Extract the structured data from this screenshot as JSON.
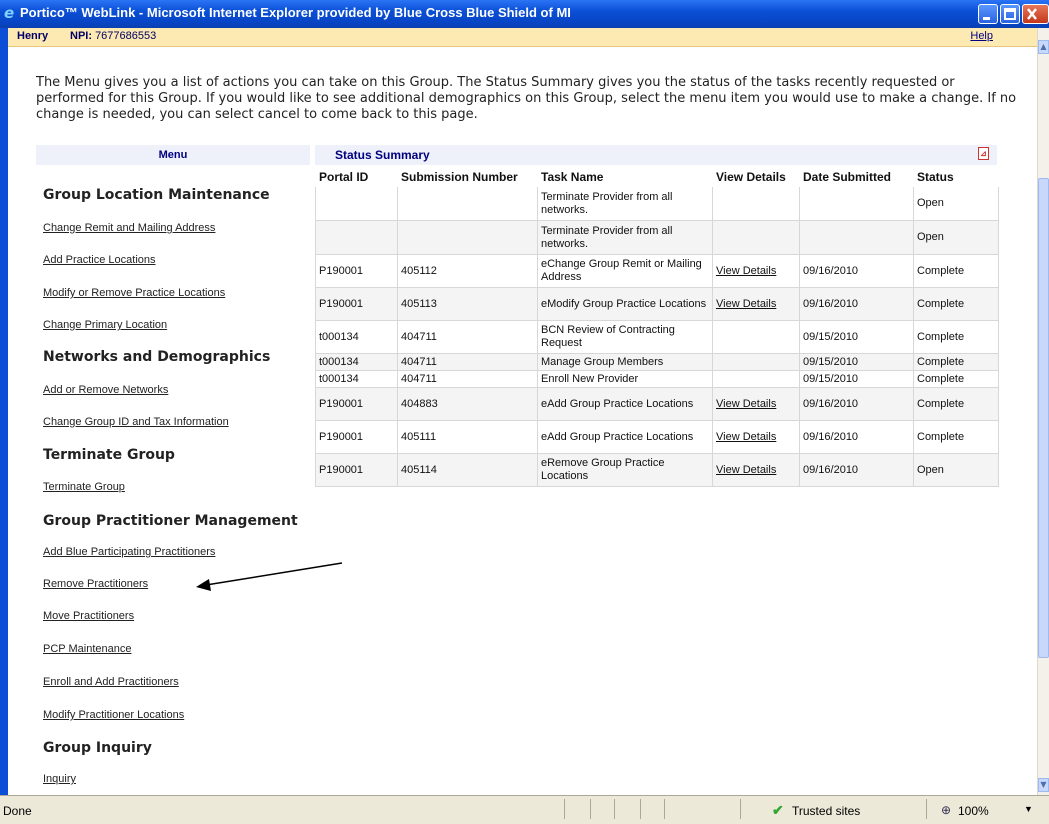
{
  "window": {
    "title": "Portico™ WebLink - Microsoft Internet Explorer provided by Blue Cross Blue Shield of MI"
  },
  "userbar": {
    "user": "Henry",
    "npi_label": "NPI:",
    "npi_value": "7677686553",
    "help": "Help"
  },
  "intro": "The Menu gives you a list of actions you can take on this Group. The Status Summary gives you the status of the tasks recently requested or performed for this Group. If you would like to see additional demographics on this Group, select the menu item you would use to make a change. If no change is needed, you can select cancel to come back to this page.",
  "menu": {
    "title": "Menu",
    "sections": [
      {
        "title": "Group Location Maintenance",
        "links": [
          "Change Remit and Mailing Address",
          "Add Practice Locations",
          "Modify or Remove Practice Locations",
          "Change Primary Location"
        ]
      },
      {
        "title": "Networks and Demographics",
        "links": [
          "Add or Remove Networks",
          "Change Group ID and Tax Information"
        ]
      },
      {
        "title": "Terminate Group",
        "links": [
          "Terminate Group"
        ]
      },
      {
        "title": "Group Practitioner Management",
        "links": [
          "Add Blue Participating Practitioners",
          "Remove Practitioners",
          "Move Practitioners",
          "PCP Maintenance",
          "Enroll and Add Practitioners",
          "Modify Practitioner Locations"
        ]
      },
      {
        "title": "Group Inquiry",
        "links": [
          "Inquiry"
        ]
      }
    ]
  },
  "status_summary": {
    "title": "Status Summary",
    "columns": [
      "Portal ID",
      "Submission Number",
      "Task Name",
      "View Details",
      "Date Submitted",
      "Status"
    ],
    "rows": [
      {
        "portal_id": "",
        "submission": "",
        "task": "Terminate Provider from all networks.",
        "details": "",
        "date": "",
        "status": "Open"
      },
      {
        "portal_id": "",
        "submission": "",
        "task": "Terminate Provider from all networks.",
        "details": "",
        "date": "",
        "status": "Open"
      },
      {
        "portal_id": "P190001",
        "submission": "405112",
        "task": "eChange Group Remit or Mailing Address",
        "details": "View Details",
        "date": "09/16/2010",
        "status": "Complete"
      },
      {
        "portal_id": "P190001",
        "submission": "405113",
        "task": "eModify Group Practice Locations",
        "details": "View Details",
        "date": "09/16/2010",
        "status": "Complete"
      },
      {
        "portal_id": "t000134",
        "submission": "404711",
        "task": "BCN Review of Contracting Request",
        "details": "",
        "date": "09/15/2010",
        "status": "Complete"
      },
      {
        "portal_id": "t000134",
        "submission": "404711",
        "task": "Manage Group Members",
        "details": "",
        "date": "09/15/2010",
        "status": "Complete"
      },
      {
        "portal_id": "t000134",
        "submission": "404711",
        "task": "Enroll New Provider",
        "details": "",
        "date": "09/15/2010",
        "status": "Complete"
      },
      {
        "portal_id": "P190001",
        "submission": "404883",
        "task": "eAdd Group Practice Locations",
        "details": "View Details",
        "date": "09/16/2010",
        "status": "Complete"
      },
      {
        "portal_id": "P190001",
        "submission": "405111",
        "task": "eAdd Group Practice Locations",
        "details": "View Details",
        "date": "09/16/2010",
        "status": "Complete"
      },
      {
        "portal_id": "P190001",
        "submission": "405114",
        "task": "eRemove Group Practice Locations",
        "details": "View Details",
        "date": "09/16/2010",
        "status": "Open"
      }
    ]
  },
  "statusbar": {
    "state": "Done",
    "zone": "Trusted sites",
    "zoom": "100%"
  },
  "icons": {
    "browser": "ie-logo-icon",
    "pdf": "pdf-icon",
    "trusted": "check-icon",
    "zoom": "magnifier-icon"
  }
}
